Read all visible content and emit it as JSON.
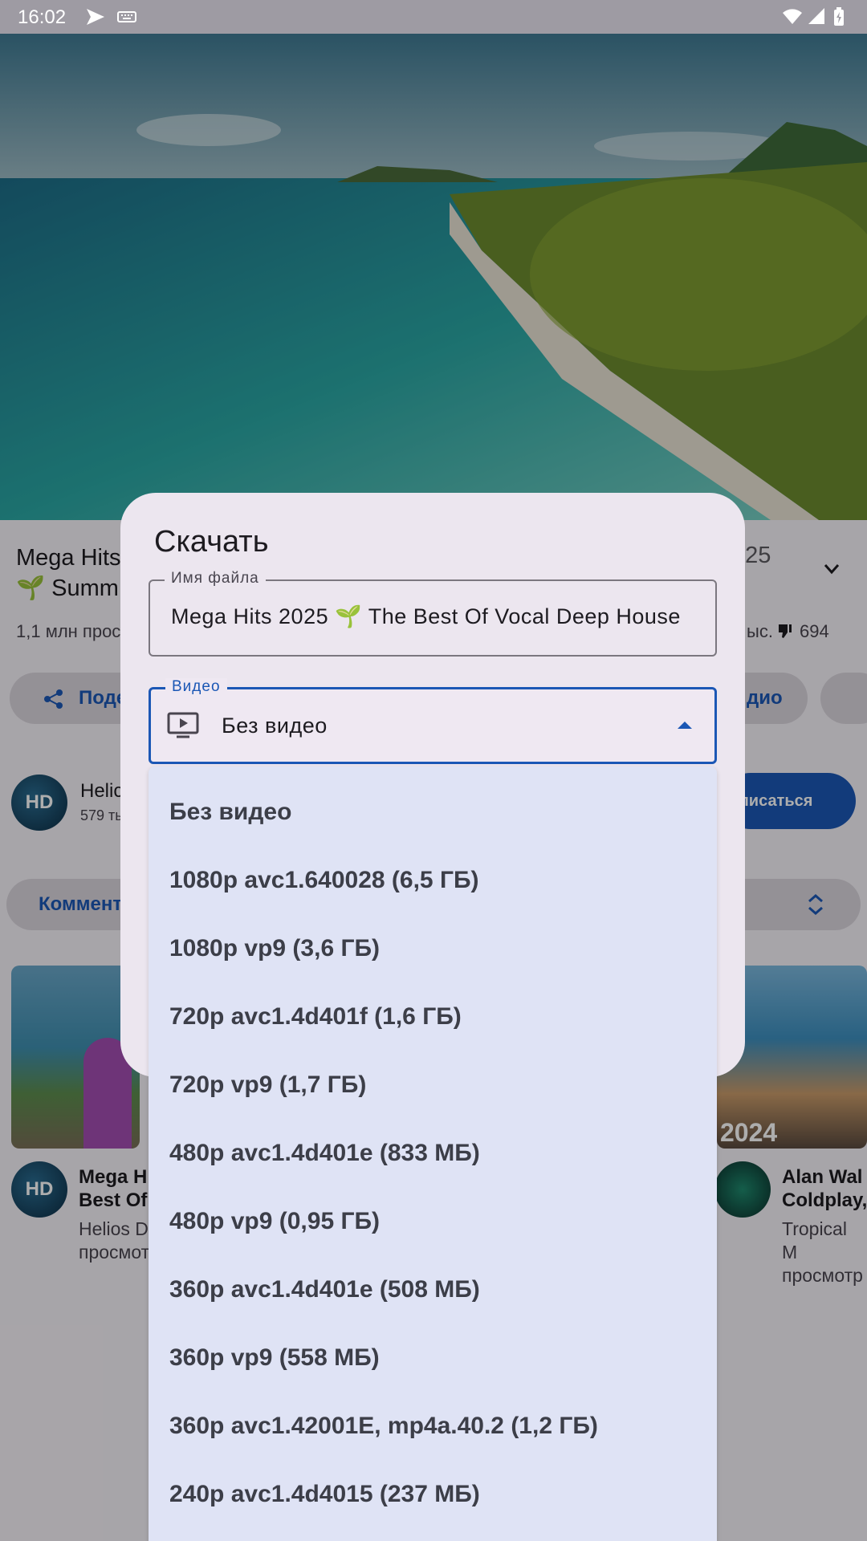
{
  "status_bar": {
    "time": "16:02"
  },
  "background": {
    "title_line1": "Mega Hits",
    "title_line2": "🌱 Summ",
    "title_right": "025",
    "views_left": "1,1 млн прос",
    "views_right": "ыс.",
    "dislikes": "694",
    "share_label": "Поде",
    "audio_label": "дио",
    "channel_name": "Helic",
    "channel_subs": "579 ты",
    "avatar_text": "HD",
    "subscribe_label": "дписаться",
    "comments_label": "Коммент",
    "card1_title_1": "Mega H",
    "card1_title_2": "Best Of",
    "card1_sub_1": "Helios D",
    "card1_sub_2": "просмот",
    "card2_title_1": "Alan Wal",
    "card2_title_2": "Coldplay,",
    "card2_sub_1": "Tropical M",
    "card2_sub_2": "просмотр",
    "thumb_year": "2024"
  },
  "dialog": {
    "title": "Скачать",
    "filename_label": "Имя файла",
    "filename_value": "Mega Hits 2025 🌱 The Best Of Vocal Deep House",
    "video_label": "Видео",
    "video_value": "Без видео"
  },
  "dropdown": {
    "options": [
      "Без видео",
      "1080p avc1.640028 (6,5 ГБ)",
      "1080p vp9 (3,6 ГБ)",
      "720p avc1.4d401f (1,6 ГБ)",
      "720p vp9 (1,7 ГБ)",
      "480p avc1.4d401e (833 МБ)",
      "480p vp9 (0,95 ГБ)",
      "360p avc1.4d401e (508 МБ)",
      "360p vp9 (558 МБ)",
      "360p avc1.42001E, mp4a.40.2 (1,2 ГБ)",
      "240p avc1.4d4015 (237 МБ)"
    ]
  },
  "colors": {
    "accent": "#1b57b5",
    "dropdown_bg": "#dfe3f5",
    "dialog_bg": "#ece6ef"
  }
}
